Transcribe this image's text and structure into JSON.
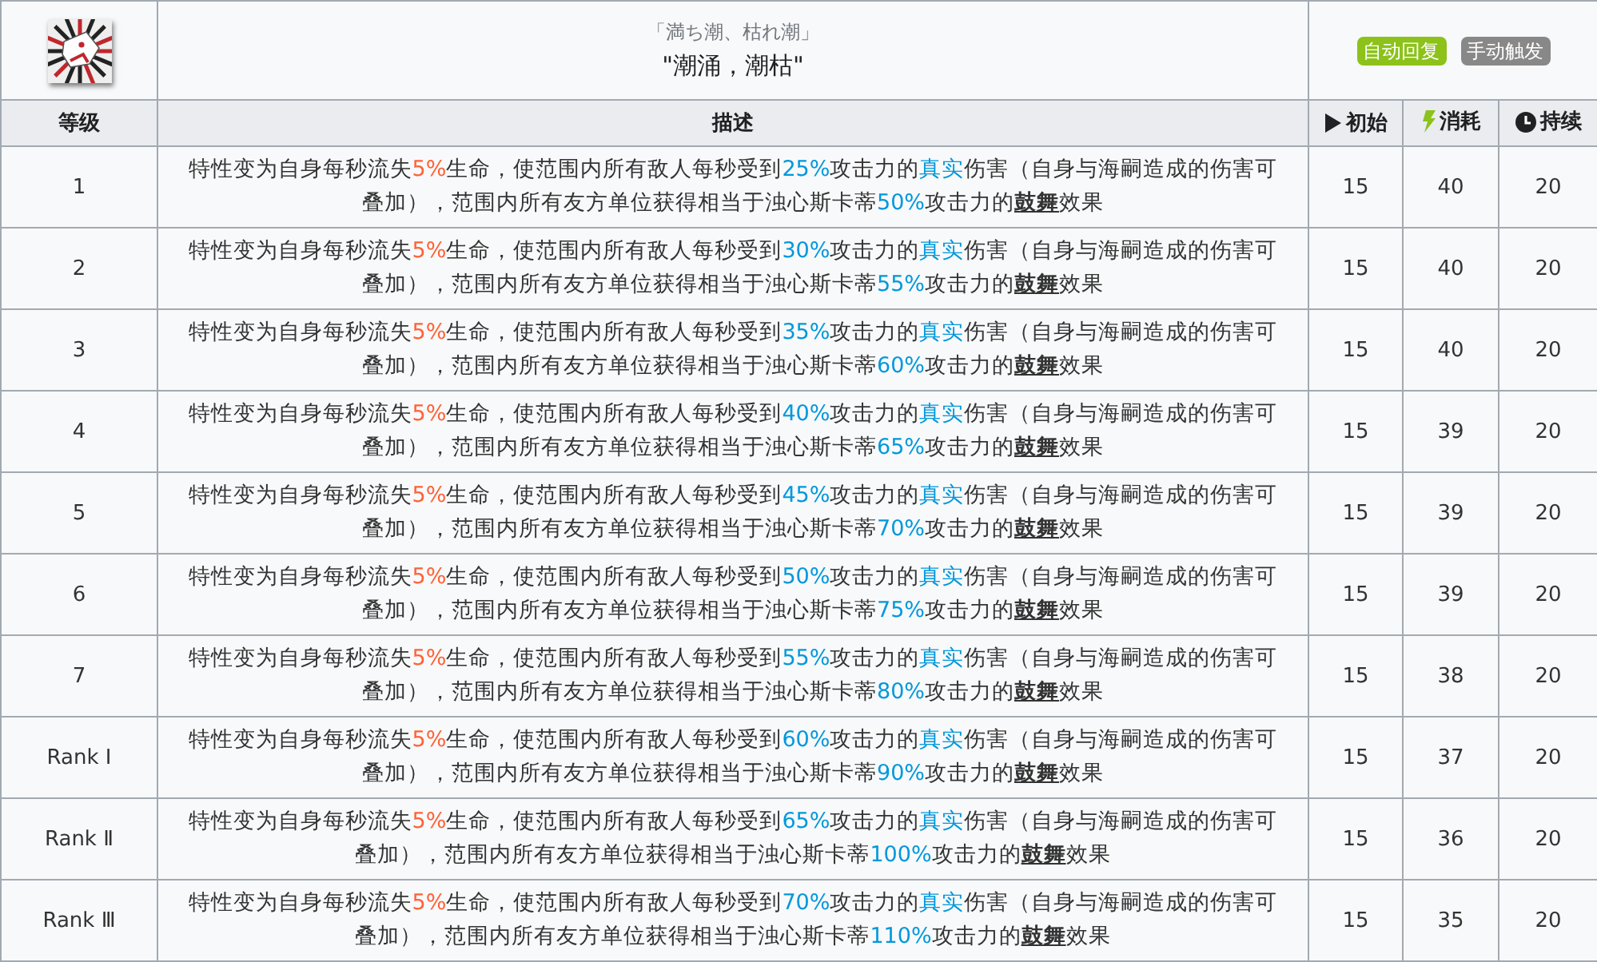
{
  "skill": {
    "original_name": "「満ち潮、枯れ潮」",
    "name": "\"潮涌，潮枯\"",
    "tags": [
      {
        "label": "自动回复",
        "color": "#8cc21a"
      },
      {
        "label": "手动触发",
        "color": "#888888"
      }
    ]
  },
  "table": {
    "columns": [
      {
        "label": "等级",
        "kind": "plain"
      },
      {
        "label": "描述",
        "kind": "plain"
      },
      {
        "label": "初始",
        "kind": "start"
      },
      {
        "label": "消耗",
        "kind": "cost"
      },
      {
        "label": "持续",
        "kind": "duration"
      }
    ],
    "rows": [
      {
        "level": "1",
        "description": [
          {
            "kind": "text",
            "text": "特性变为自身每秒流失"
          },
          {
            "kind": "penalty",
            "text": "5%"
          },
          {
            "kind": "text",
            "text": "生命，使范围内所有敌人每秒受到"
          },
          {
            "kind": "value",
            "text": "25%"
          },
          {
            "kind": "text",
            "text": "攻击力的"
          },
          {
            "kind": "keyword",
            "text": "真实"
          },
          {
            "kind": "text",
            "text": "伤害（自身与海嗣造成的伤害可叠加），范围内所有友方单位获得相当于浊心斯卡蒂"
          },
          {
            "kind": "value",
            "text": "50%"
          },
          {
            "kind": "text",
            "text": "攻击力的"
          },
          {
            "kind": "term",
            "text": "鼓舞"
          },
          {
            "kind": "text",
            "text": "效果"
          }
        ],
        "initial": "15",
        "cost": "40",
        "duration": "20"
      },
      {
        "level": "2",
        "description": [
          {
            "kind": "text",
            "text": "特性变为自身每秒流失"
          },
          {
            "kind": "penalty",
            "text": "5%"
          },
          {
            "kind": "text",
            "text": "生命，使范围内所有敌人每秒受到"
          },
          {
            "kind": "value",
            "text": "30%"
          },
          {
            "kind": "text",
            "text": "攻击力的"
          },
          {
            "kind": "keyword",
            "text": "真实"
          },
          {
            "kind": "text",
            "text": "伤害（自身与海嗣造成的伤害可叠加），范围内所有友方单位获得相当于浊心斯卡蒂"
          },
          {
            "kind": "value",
            "text": "55%"
          },
          {
            "kind": "text",
            "text": "攻击力的"
          },
          {
            "kind": "term",
            "text": "鼓舞"
          },
          {
            "kind": "text",
            "text": "效果"
          }
        ],
        "initial": "15",
        "cost": "40",
        "duration": "20"
      },
      {
        "level": "3",
        "description": [
          {
            "kind": "text",
            "text": "特性变为自身每秒流失"
          },
          {
            "kind": "penalty",
            "text": "5%"
          },
          {
            "kind": "text",
            "text": "生命，使范围内所有敌人每秒受到"
          },
          {
            "kind": "value",
            "text": "35%"
          },
          {
            "kind": "text",
            "text": "攻击力的"
          },
          {
            "kind": "keyword",
            "text": "真实"
          },
          {
            "kind": "text",
            "text": "伤害（自身与海嗣造成的伤害可叠加），范围内所有友方单位获得相当于浊心斯卡蒂"
          },
          {
            "kind": "value",
            "text": "60%"
          },
          {
            "kind": "text",
            "text": "攻击力的"
          },
          {
            "kind": "term",
            "text": "鼓舞"
          },
          {
            "kind": "text",
            "text": "效果"
          }
        ],
        "initial": "15",
        "cost": "40",
        "duration": "20"
      },
      {
        "level": "4",
        "description": [
          {
            "kind": "text",
            "text": "特性变为自身每秒流失"
          },
          {
            "kind": "penalty",
            "text": "5%"
          },
          {
            "kind": "text",
            "text": "生命，使范围内所有敌人每秒受到"
          },
          {
            "kind": "value",
            "text": "40%"
          },
          {
            "kind": "text",
            "text": "攻击力的"
          },
          {
            "kind": "keyword",
            "text": "真实"
          },
          {
            "kind": "text",
            "text": "伤害（自身与海嗣造成的伤害可叠加），范围内所有友方单位获得相当于浊心斯卡蒂"
          },
          {
            "kind": "value",
            "text": "65%"
          },
          {
            "kind": "text",
            "text": "攻击力的"
          },
          {
            "kind": "term",
            "text": "鼓舞"
          },
          {
            "kind": "text",
            "text": "效果"
          }
        ],
        "initial": "15",
        "cost": "39",
        "duration": "20"
      },
      {
        "level": "5",
        "description": [
          {
            "kind": "text",
            "text": "特性变为自身每秒流失"
          },
          {
            "kind": "penalty",
            "text": "5%"
          },
          {
            "kind": "text",
            "text": "生命，使范围内所有敌人每秒受到"
          },
          {
            "kind": "value",
            "text": "45%"
          },
          {
            "kind": "text",
            "text": "攻击力的"
          },
          {
            "kind": "keyword",
            "text": "真实"
          },
          {
            "kind": "text",
            "text": "伤害（自身与海嗣造成的伤害可叠加），范围内所有友方单位获得相当于浊心斯卡蒂"
          },
          {
            "kind": "value",
            "text": "70%"
          },
          {
            "kind": "text",
            "text": "攻击力的"
          },
          {
            "kind": "term",
            "text": "鼓舞"
          },
          {
            "kind": "text",
            "text": "效果"
          }
        ],
        "initial": "15",
        "cost": "39",
        "duration": "20"
      },
      {
        "level": "6",
        "description": [
          {
            "kind": "text",
            "text": "特性变为自身每秒流失"
          },
          {
            "kind": "penalty",
            "text": "5%"
          },
          {
            "kind": "text",
            "text": "生命，使范围内所有敌人每秒受到"
          },
          {
            "kind": "value",
            "text": "50%"
          },
          {
            "kind": "text",
            "text": "攻击力的"
          },
          {
            "kind": "keyword",
            "text": "真实"
          },
          {
            "kind": "text",
            "text": "伤害（自身与海嗣造成的伤害可叠加），范围内所有友方单位获得相当于浊心斯卡蒂"
          },
          {
            "kind": "value",
            "text": "75%"
          },
          {
            "kind": "text",
            "text": "攻击力的"
          },
          {
            "kind": "term",
            "text": "鼓舞"
          },
          {
            "kind": "text",
            "text": "效果"
          }
        ],
        "initial": "15",
        "cost": "39",
        "duration": "20"
      },
      {
        "level": "7",
        "description": [
          {
            "kind": "text",
            "text": "特性变为自身每秒流失"
          },
          {
            "kind": "penalty",
            "text": "5%"
          },
          {
            "kind": "text",
            "text": "生命，使范围内所有敌人每秒受到"
          },
          {
            "kind": "value",
            "text": "55%"
          },
          {
            "kind": "text",
            "text": "攻击力的"
          },
          {
            "kind": "keyword",
            "text": "真实"
          },
          {
            "kind": "text",
            "text": "伤害（自身与海嗣造成的伤害可叠加），范围内所有友方单位获得相当于浊心斯卡蒂"
          },
          {
            "kind": "value",
            "text": "80%"
          },
          {
            "kind": "text",
            "text": "攻击力的"
          },
          {
            "kind": "term",
            "text": "鼓舞"
          },
          {
            "kind": "text",
            "text": "效果"
          }
        ],
        "initial": "15",
        "cost": "38",
        "duration": "20"
      },
      {
        "level": "Rank Ⅰ",
        "description": [
          {
            "kind": "text",
            "text": "特性变为自身每秒流失"
          },
          {
            "kind": "penalty",
            "text": "5%"
          },
          {
            "kind": "text",
            "text": "生命，使范围内所有敌人每秒受到"
          },
          {
            "kind": "value",
            "text": "60%"
          },
          {
            "kind": "text",
            "text": "攻击力的"
          },
          {
            "kind": "keyword",
            "text": "真实"
          },
          {
            "kind": "text",
            "text": "伤害（自身与海嗣造成的伤害可叠加），范围内所有友方单位获得相当于浊心斯卡蒂"
          },
          {
            "kind": "value",
            "text": "90%"
          },
          {
            "kind": "text",
            "text": "攻击力的"
          },
          {
            "kind": "term",
            "text": "鼓舞"
          },
          {
            "kind": "text",
            "text": "效果"
          }
        ],
        "initial": "15",
        "cost": "37",
        "duration": "20"
      },
      {
        "level": "Rank Ⅱ",
        "description": [
          {
            "kind": "text",
            "text": "特性变为自身每秒流失"
          },
          {
            "kind": "penalty",
            "text": "5%"
          },
          {
            "kind": "text",
            "text": "生命，使范围内所有敌人每秒受到"
          },
          {
            "kind": "value",
            "text": "65%"
          },
          {
            "kind": "text",
            "text": "攻击力的"
          },
          {
            "kind": "keyword",
            "text": "真实"
          },
          {
            "kind": "text",
            "text": "伤害（自身与海嗣造成的伤害可叠加），范围内所有友方单位获得相当于浊心斯卡蒂"
          },
          {
            "kind": "value",
            "text": "100%"
          },
          {
            "kind": "text",
            "text": "攻击力的"
          },
          {
            "kind": "term",
            "text": "鼓舞"
          },
          {
            "kind": "text",
            "text": "效果"
          }
        ],
        "initial": "15",
        "cost": "36",
        "duration": "20"
      },
      {
        "level": "Rank Ⅲ",
        "description": [
          {
            "kind": "text",
            "text": "特性变为自身每秒流失"
          },
          {
            "kind": "penalty",
            "text": "5%"
          },
          {
            "kind": "text",
            "text": "生命，使范围内所有敌人每秒受到"
          },
          {
            "kind": "value",
            "text": "70%"
          },
          {
            "kind": "text",
            "text": "攻击力的"
          },
          {
            "kind": "keyword",
            "text": "真实"
          },
          {
            "kind": "text",
            "text": "伤害（自身与海嗣造成的伤害可叠加），范围内所有友方单位获得相当于浊心斯卡蒂"
          },
          {
            "kind": "value",
            "text": "110%"
          },
          {
            "kind": "text",
            "text": "攻击力的"
          },
          {
            "kind": "term",
            "text": "鼓舞"
          },
          {
            "kind": "text",
            "text": "效果"
          }
        ],
        "initial": "15",
        "cost": "35",
        "duration": "20"
      }
    ]
  }
}
